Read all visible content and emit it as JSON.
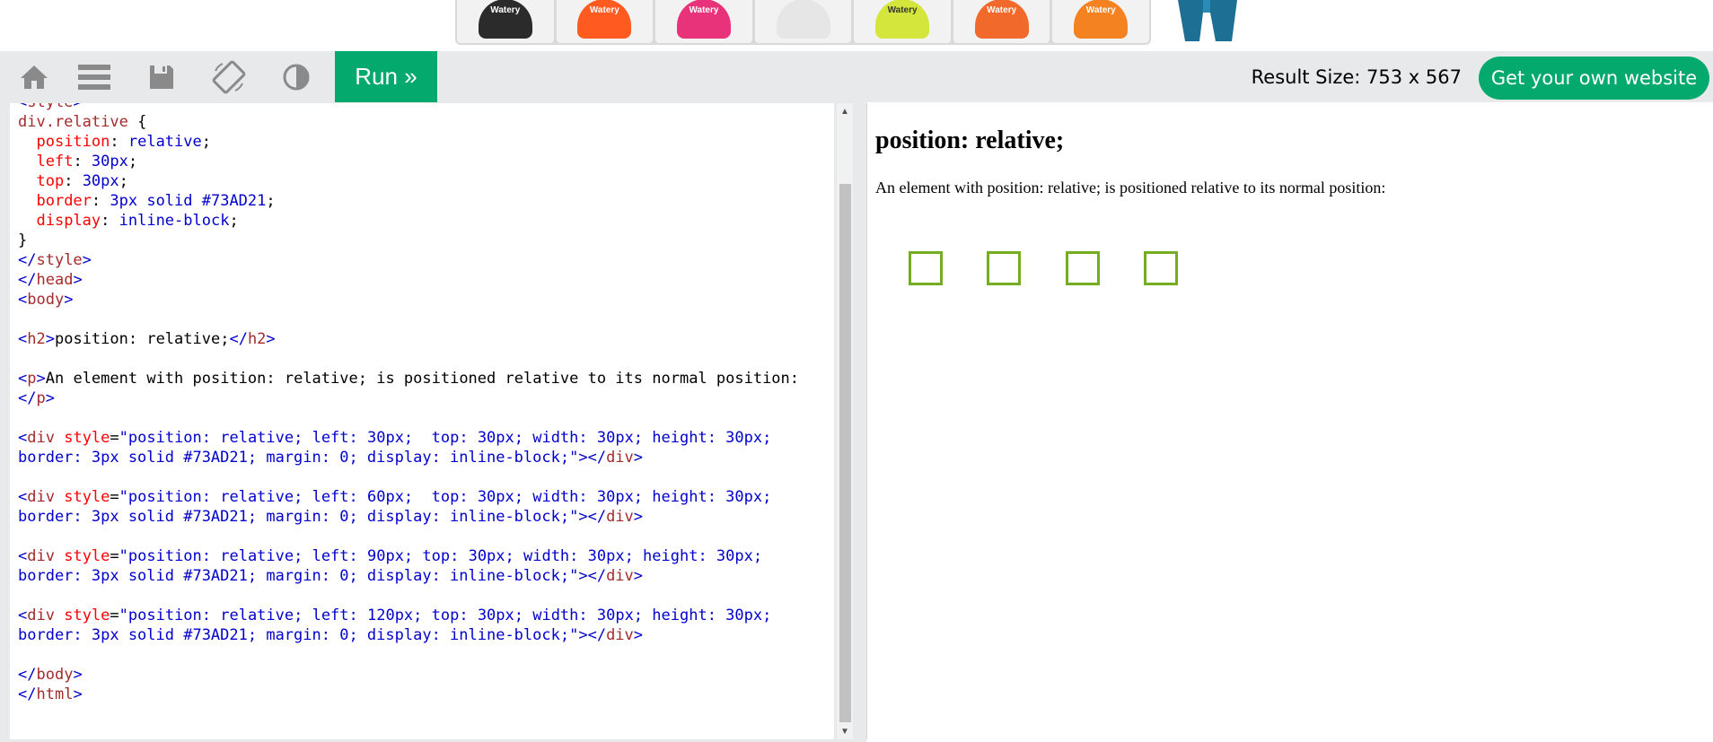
{
  "ads": {
    "brand": "Watery",
    "items": [
      {
        "name": "black-bag",
        "color": "#2b2b2b"
      },
      {
        "name": "orange-bag",
        "color": "#ff5a1f"
      },
      {
        "name": "pink-buoy",
        "color": "#e8337a"
      },
      {
        "name": "goggles",
        "color": "#e6e6e6"
      },
      {
        "name": "yellow-buoy",
        "color": "#d4e63c"
      },
      {
        "name": "orange-buoy",
        "color": "#f26a2b"
      },
      {
        "name": "orange-cap",
        "color": "#f58220"
      }
    ]
  },
  "toolbar": {
    "home_icon": "home-icon",
    "menu_icon": "menu-icon",
    "save_icon": "save-icon",
    "rotate_icon": "rotate-icon",
    "theme_icon": "contrast-icon",
    "run_label": "Run »",
    "result_size_label": "Result Size: ",
    "result_size_value": "753 x 567",
    "own_site_label": "Get your own website"
  },
  "code_lines": [
    [
      {
        "c": "ang",
        "t": "<"
      },
      {
        "c": "tag",
        "t": "style"
      },
      {
        "c": "ang",
        "t": ">"
      }
    ],
    [
      {
        "c": "sel",
        "t": "div.relative"
      },
      {
        "c": "txt",
        "t": " {"
      }
    ],
    [
      {
        "c": "txt",
        "t": "  "
      },
      {
        "c": "prop",
        "t": "position"
      },
      {
        "c": "txt",
        "t": ": "
      },
      {
        "c": "val",
        "t": "relative"
      },
      {
        "c": "txt",
        "t": ";"
      }
    ],
    [
      {
        "c": "txt",
        "t": "  "
      },
      {
        "c": "prop",
        "t": "left"
      },
      {
        "c": "txt",
        "t": ": "
      },
      {
        "c": "val",
        "t": "30px"
      },
      {
        "c": "txt",
        "t": ";"
      }
    ],
    [
      {
        "c": "txt",
        "t": "  "
      },
      {
        "c": "prop",
        "t": "top"
      },
      {
        "c": "txt",
        "t": ": "
      },
      {
        "c": "val",
        "t": "30px"
      },
      {
        "c": "txt",
        "t": ";"
      }
    ],
    [
      {
        "c": "txt",
        "t": "  "
      },
      {
        "c": "prop",
        "t": "border"
      },
      {
        "c": "txt",
        "t": ": "
      },
      {
        "c": "val",
        "t": "3px solid #73AD21"
      },
      {
        "c": "txt",
        "t": ";"
      }
    ],
    [
      {
        "c": "txt",
        "t": "  "
      },
      {
        "c": "prop",
        "t": "display"
      },
      {
        "c": "txt",
        "t": ": "
      },
      {
        "c": "val",
        "t": "inline-block"
      },
      {
        "c": "txt",
        "t": ";"
      }
    ],
    [
      {
        "c": "txt",
        "t": "}"
      }
    ],
    [
      {
        "c": "ang",
        "t": "</"
      },
      {
        "c": "tag",
        "t": "style"
      },
      {
        "c": "ang",
        "t": ">"
      }
    ],
    [
      {
        "c": "ang",
        "t": "</"
      },
      {
        "c": "tag",
        "t": "head"
      },
      {
        "c": "ang",
        "t": ">"
      }
    ],
    [
      {
        "c": "ang",
        "t": "<"
      },
      {
        "c": "tag",
        "t": "body"
      },
      {
        "c": "ang",
        "t": ">"
      }
    ],
    [],
    [
      {
        "c": "ang",
        "t": "<"
      },
      {
        "c": "tag",
        "t": "h2"
      },
      {
        "c": "ang",
        "t": ">"
      },
      {
        "c": "txt",
        "t": "position: relative;"
      },
      {
        "c": "ang",
        "t": "</"
      },
      {
        "c": "tag",
        "t": "h2"
      },
      {
        "c": "ang",
        "t": ">"
      }
    ],
    [],
    [
      {
        "c": "ang",
        "t": "<"
      },
      {
        "c": "tag",
        "t": "p"
      },
      {
        "c": "ang",
        "t": ">"
      },
      {
        "c": "txt",
        "t": "An element with position: relative; is positioned relative to its normal position:"
      }
    ],
    [
      {
        "c": "ang",
        "t": "</"
      },
      {
        "c": "tag",
        "t": "p"
      },
      {
        "c": "ang",
        "t": ">"
      }
    ],
    [],
    [
      {
        "c": "ang",
        "t": "<"
      },
      {
        "c": "tag",
        "t": "div"
      },
      {
        "c": "txt",
        "t": " "
      },
      {
        "c": "attr",
        "t": "style"
      },
      {
        "c": "txt",
        "t": "="
      },
      {
        "c": "str",
        "t": "\"position: relative; left: 30px;  top: 30px; width: 30px; height: 30px;"
      }
    ],
    [
      {
        "c": "str",
        "t": "border: 3px solid #73AD21; margin: 0; display: inline-block;\""
      },
      {
        "c": "ang",
        "t": ">"
      },
      {
        "c": "ang",
        "t": "</"
      },
      {
        "c": "tag",
        "t": "div"
      },
      {
        "c": "ang",
        "t": ">"
      }
    ],
    [],
    [
      {
        "c": "ang",
        "t": "<"
      },
      {
        "c": "tag",
        "t": "div"
      },
      {
        "c": "txt",
        "t": " "
      },
      {
        "c": "attr",
        "t": "style"
      },
      {
        "c": "txt",
        "t": "="
      },
      {
        "c": "str",
        "t": "\"position: relative; left: 60px;  top: 30px; width: 30px; height: 30px;"
      }
    ],
    [
      {
        "c": "str",
        "t": "border: 3px solid #73AD21; margin: 0; display: inline-block;\""
      },
      {
        "c": "ang",
        "t": ">"
      },
      {
        "c": "ang",
        "t": "</"
      },
      {
        "c": "tag",
        "t": "div"
      },
      {
        "c": "ang",
        "t": ">"
      }
    ],
    [],
    [
      {
        "c": "ang",
        "t": "<"
      },
      {
        "c": "tag",
        "t": "div"
      },
      {
        "c": "txt",
        "t": " "
      },
      {
        "c": "attr",
        "t": "style"
      },
      {
        "c": "txt",
        "t": "="
      },
      {
        "c": "str",
        "t": "\"position: relative; left: 90px; top: 30px; width: 30px; height: 30px;"
      }
    ],
    [
      {
        "c": "str",
        "t": "border: 3px solid #73AD21; margin: 0; display: inline-block;\""
      },
      {
        "c": "ang",
        "t": ">"
      },
      {
        "c": "ang",
        "t": "</"
      },
      {
        "c": "tag",
        "t": "div"
      },
      {
        "c": "ang",
        "t": ">"
      }
    ],
    [],
    [
      {
        "c": "ang",
        "t": "<"
      },
      {
        "c": "tag",
        "t": "div"
      },
      {
        "c": "txt",
        "t": " "
      },
      {
        "c": "attr",
        "t": "style"
      },
      {
        "c": "txt",
        "t": "="
      },
      {
        "c": "str",
        "t": "\"position: relative; left: 120px; top: 30px; width: 30px; height: 30px;"
      }
    ],
    [
      {
        "c": "str",
        "t": "border: 3px solid #73AD21; margin: 0; display: inline-block;\""
      },
      {
        "c": "ang",
        "t": ">"
      },
      {
        "c": "ang",
        "t": "</"
      },
      {
        "c": "tag",
        "t": "div"
      },
      {
        "c": "ang",
        "t": ">"
      }
    ],
    [],
    [
      {
        "c": "ang",
        "t": "</"
      },
      {
        "c": "tag",
        "t": "body"
      },
      {
        "c": "ang",
        "t": ">"
      }
    ],
    [
      {
        "c": "ang",
        "t": "</"
      },
      {
        "c": "tag",
        "t": "html"
      },
      {
        "c": "ang",
        "t": ">"
      }
    ]
  ],
  "result": {
    "heading": "position: relative;",
    "paragraph": "An element with position: relative; is positioned relative to its normal position:",
    "box_border_color": "#73AD21",
    "box_count": 4
  },
  "colors": {
    "accent": "#04aa6d",
    "toolbar_bg": "#e7e9eb"
  }
}
